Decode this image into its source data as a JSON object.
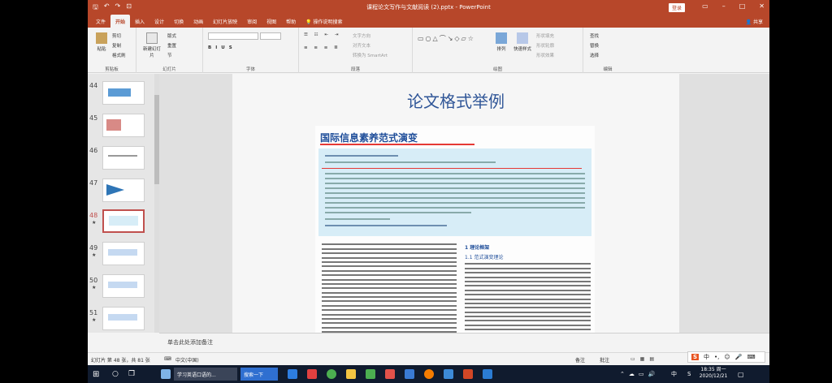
{
  "window": {
    "title": "课程论文写作与文献阅读 (2).pptx - PowerPoint",
    "login": "登录",
    "share": "共享",
    "quick_access": [
      "保存",
      "撤销",
      "重做",
      "从头开始"
    ]
  },
  "tabs": [
    "文件",
    "开始",
    "插入",
    "设计",
    "切换",
    "动画",
    "幻灯片放映",
    "审阅",
    "视图",
    "帮助",
    "操作说明搜索"
  ],
  "ribbon": {
    "clipboard": {
      "paste": "粘贴",
      "cut": "剪切",
      "copy": "复制",
      "format_painter": "格式刷",
      "label": "剪贴板"
    },
    "slides": {
      "new_slide": "新建幻灯片",
      "layout": "版式",
      "reset": "重置",
      "section": "节",
      "label": "幻灯片"
    },
    "font": {
      "label": "字体"
    },
    "paragraph": {
      "text_direction": "文字方向",
      "align_text": "对齐文本",
      "smartart": "转换为 SmartArt",
      "label": "段落"
    },
    "drawing": {
      "arrange": "排列",
      "quick_styles": "快速样式",
      "shape_fill": "形状填充",
      "shape_outline": "形状轮廓",
      "shape_effects": "形状效果",
      "label": "绘图"
    },
    "editing": {
      "find": "查找",
      "replace": "替换",
      "select": "选择",
      "label": "编辑"
    }
  },
  "thumbnails": [
    {
      "num": "44",
      "star": ""
    },
    {
      "num": "45",
      "star": ""
    },
    {
      "num": "46",
      "star": ""
    },
    {
      "num": "47",
      "star": ""
    },
    {
      "num": "48",
      "star": "★"
    },
    {
      "num": "49",
      "star": "★"
    },
    {
      "num": "50",
      "star": "★"
    },
    {
      "num": "51",
      "star": "★"
    },
    {
      "num": "52",
      "star": "★"
    }
  ],
  "slide": {
    "title": "论文格式举例",
    "paper_title": "国际信息素养范式演变",
    "section_heading": "1 理论框架",
    "subsection_heading": "1.1 范式演变理论"
  },
  "notes_placeholder": "单击此处添加备注",
  "status": {
    "slide_info": "幻灯片 第 48 张，共 81 张",
    "language": "中文(中国)",
    "notes": "备注",
    "comments": "批注"
  },
  "ime": {
    "lang": "中",
    "ui_text": "中"
  },
  "taskbar": {
    "items": [
      "学习英语口语的...",
      "搜索一下"
    ],
    "time": "18:35 周一",
    "date": "2020/12/21",
    "ime": "中"
  },
  "colors": {
    "accent": "#b7472a",
    "title_blue": "#2f5597",
    "abstract_bg": "#d7edf7"
  }
}
